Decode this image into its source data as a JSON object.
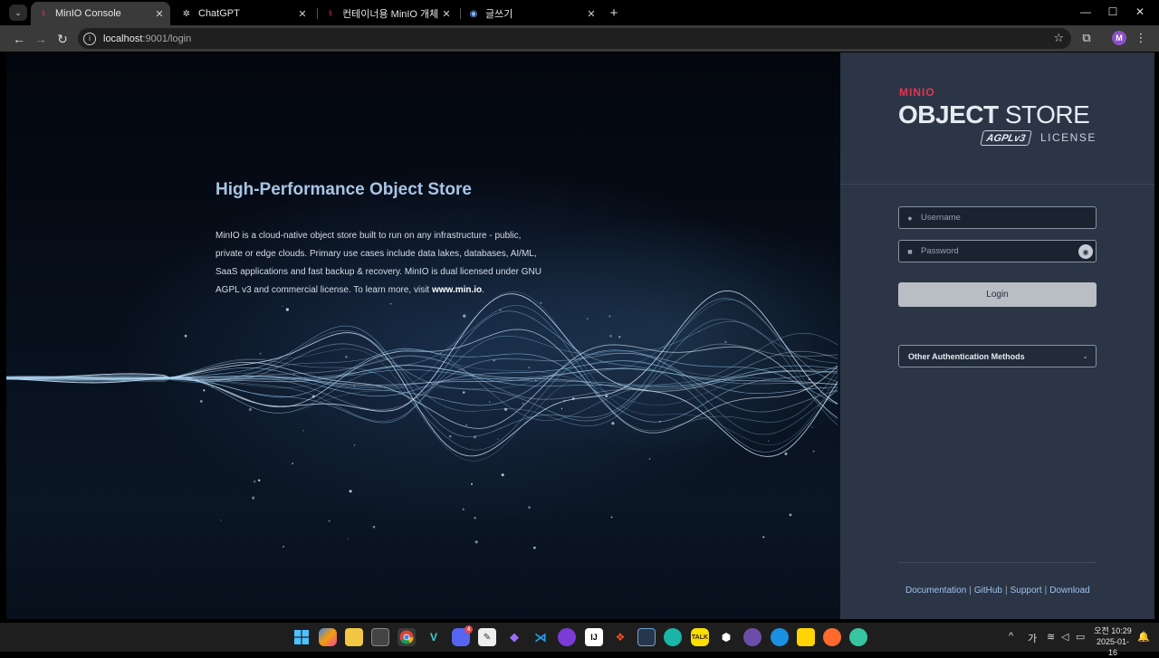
{
  "browser": {
    "tabs": [
      {
        "label": "MinIO Console",
        "active": true
      },
      {
        "label": "ChatGPT",
        "active": false
      },
      {
        "label": "컨테이너용 MinIO 개체 스토리",
        "active": false
      },
      {
        "label": "글쓰기",
        "active": false
      }
    ],
    "url_host": "localhost",
    "url_path": ":9001/login",
    "profile_initial": "M"
  },
  "hero": {
    "title": "High-Performance Object Store",
    "body": "MinIO is a cloud-native object store built to run on any infrastructure - public, private or edge clouds. Primary use cases include data lakes, databases, AI/ML, SaaS applications and fast backup & recovery. MinIO is dual licensed under GNU AGPL v3 and commercial license. To learn more, visit ",
    "link": "www.min.io",
    "suffix": "."
  },
  "brand": {
    "minio": "MINIO",
    "object": "OBJECT",
    "store": "STORE",
    "agpl": "AGPLv3",
    "license": "LICENSE"
  },
  "login": {
    "username_placeholder": "Username",
    "password_placeholder": "Password",
    "button": "Login",
    "other_auth": "Other Authentication Methods"
  },
  "footer": {
    "links": [
      "Documentation",
      "GitHub",
      "Support",
      "Download"
    ]
  },
  "taskbar": {
    "discord_badge": "4",
    "ime": "가",
    "time_period": "오전 10:29",
    "date": "2025-01-16"
  },
  "colors": {
    "panel_bg": "#2b3546",
    "minio_red": "#e8334d",
    "link_blue": "#9ec3ee",
    "hero_title": "#a9c4e6"
  }
}
